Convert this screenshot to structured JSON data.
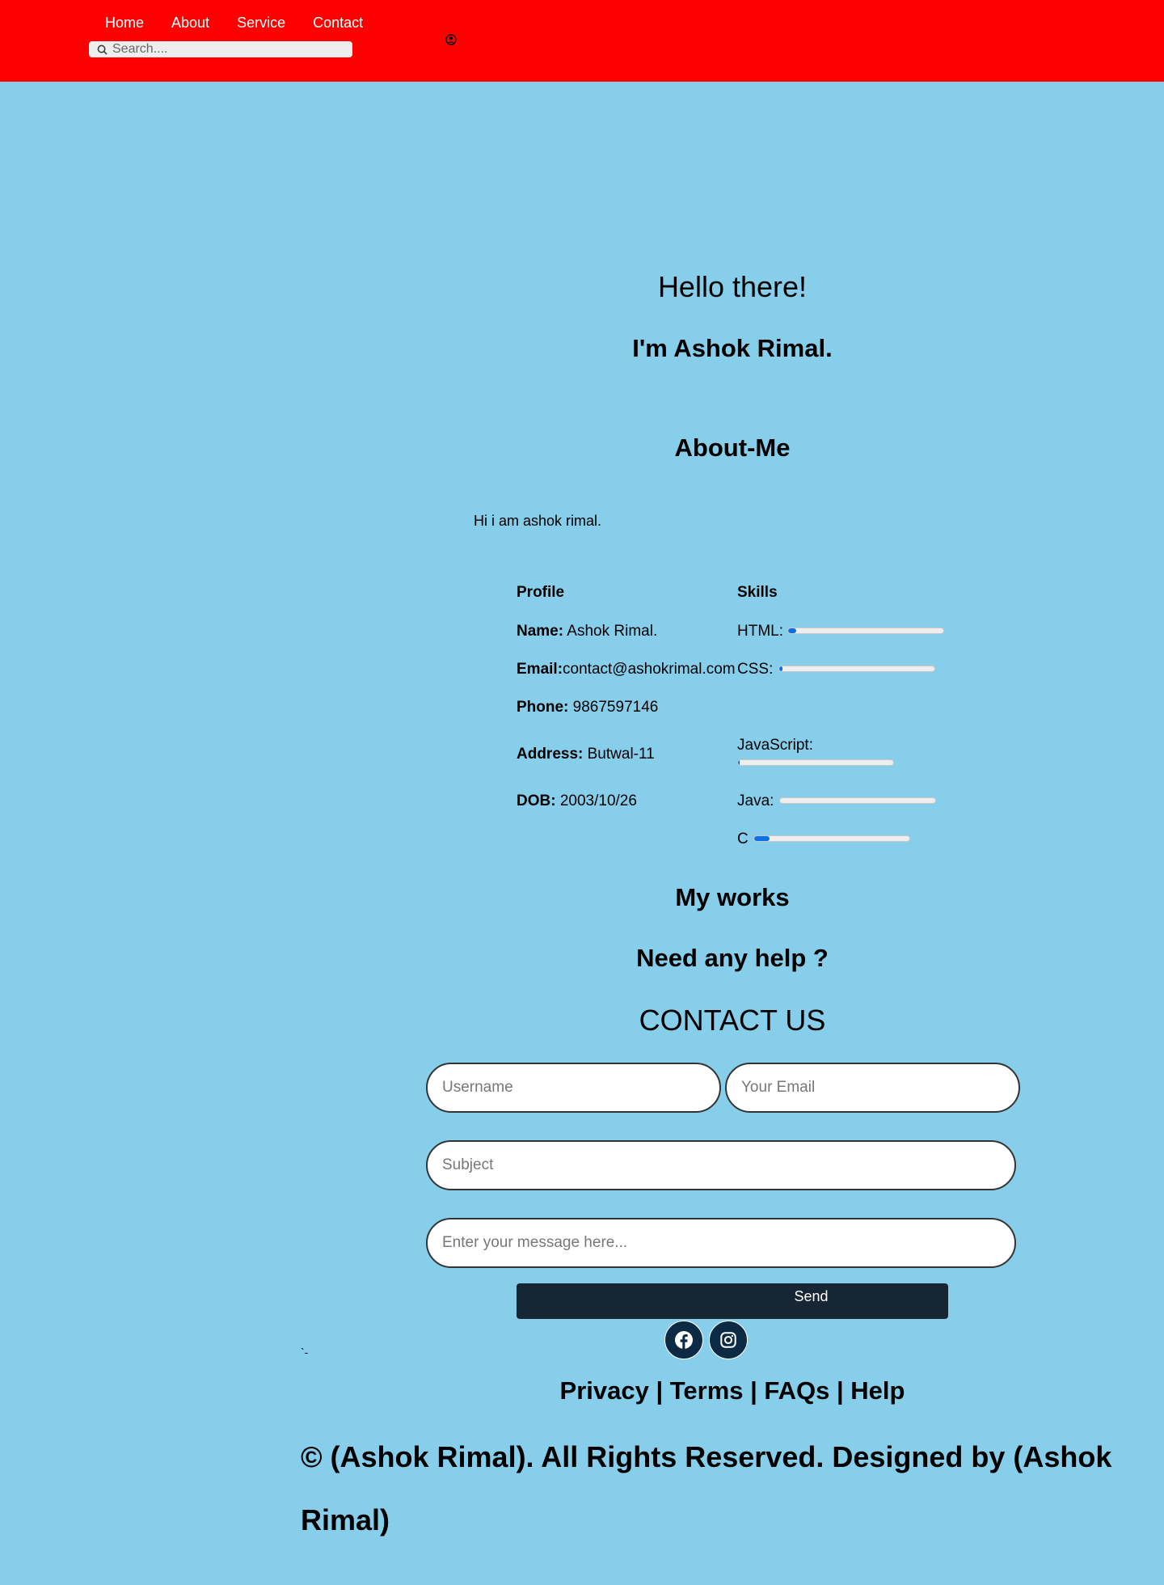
{
  "nav": {
    "items": [
      {
        "label": "Home"
      },
      {
        "label": "About"
      },
      {
        "label": "Service"
      },
      {
        "label": "Contact"
      }
    ],
    "search_placeholder": "Search...."
  },
  "hero": {
    "greeting": "Hello there!",
    "name": "I'm Ashok Rimal."
  },
  "about": {
    "title": "About-Me",
    "intro": "Hi i am ashok rimal.",
    "profile": {
      "title": "Profile",
      "name_label": "Name:",
      "name_value": " Ashok Rimal.",
      "email_label": "Email:",
      "email_value": "contact@ashokrimal.com",
      "phone_label": "Phone:",
      "phone_value": " 9867597146",
      "address_label": "Address:",
      "address_value": " Butwal-11",
      "dob_label": "DOB:",
      "dob_value": " 2003/10/26"
    },
    "skills": {
      "title": "Skills",
      "items": [
        {
          "label": "HTML:",
          "progress": 5
        },
        {
          "label": "CSS:",
          "progress": 2
        },
        {
          "label": "JavaScript:",
          "progress": 1
        },
        {
          "label": "Java:",
          "progress": 0
        },
        {
          "label": "C",
          "progress": 10
        }
      ],
      "accent_color": "#0a72e6"
    }
  },
  "sections": {
    "works_title": "My works",
    "help_title": "Need any help ?",
    "contact_title": "CONTACT US"
  },
  "form": {
    "username_placeholder": "Username",
    "email_placeholder": "Your Email",
    "subject_placeholder": "Subject",
    "message_placeholder": "Enter your message here...",
    "send_label": "Send"
  },
  "social": {
    "icons": [
      "facebook-icon",
      "instagram-icon"
    ]
  },
  "footer": {
    "stray_mark": "`-",
    "links_text": "Privacy | Terms | FAQs | Help",
    "copyright": "© (Ashok Rimal). All Rights Reserved. Designed by (Ashok Rimal)"
  },
  "colors": {
    "header": "#ff0000",
    "page": "#87ceeb",
    "button": "#162635"
  }
}
